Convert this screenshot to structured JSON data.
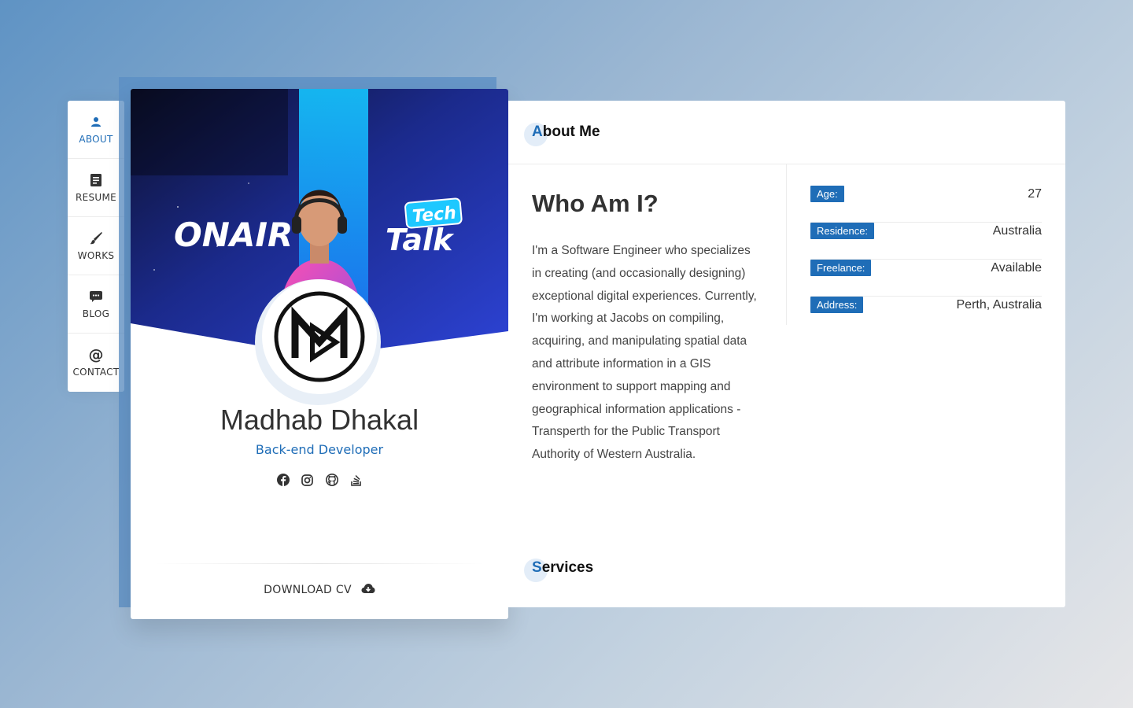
{
  "nav": {
    "items": [
      {
        "label": "ABOUT",
        "icon": "user-icon",
        "active": true
      },
      {
        "label": "RESUME",
        "icon": "document-icon",
        "active": false
      },
      {
        "label": "WORKS",
        "icon": "brush-icon",
        "active": false
      },
      {
        "label": "BLOG",
        "icon": "chat-icon",
        "active": false
      },
      {
        "label": "CONTACT",
        "icon": "at-icon",
        "active": false
      }
    ]
  },
  "profile": {
    "cover_text_left": "ONAIR",
    "cover_text_right_top": "Tech",
    "cover_text_right_bottom": "Talk",
    "name": "Madhab Dhakal",
    "role": "Back-end Developer",
    "socials": [
      "facebook-icon",
      "instagram-icon",
      "github-icon",
      "stackoverflow-icon"
    ],
    "download_label": "DOWNLOAD CV"
  },
  "about": {
    "section_first_letter": "A",
    "section_rest": "bout Me",
    "heading": "Who Am I?",
    "bio": "I'm a Software Engineer who specializes in creating (and occasionally designing) exceptional digital experiences. Currently, I'm working at Jacobs on compiling, acquiring, and manipulating spatial data and attribute information in a GIS environment to support mapping and geographical information applications - Transperth for the Public Transport Authority of Western Australia.",
    "info": [
      {
        "label": "Age:",
        "value": "27"
      },
      {
        "label": "Residence:",
        "value": "Australia"
      },
      {
        "label": "Freelance:",
        "value": "Available"
      },
      {
        "label": "Address:",
        "value": "Perth, Australia"
      }
    ]
  },
  "services": {
    "section_first_letter": "S",
    "section_rest": "ervices"
  },
  "colors": {
    "accent": "#1f6db7",
    "cover_blue": "#2a3fc9"
  }
}
